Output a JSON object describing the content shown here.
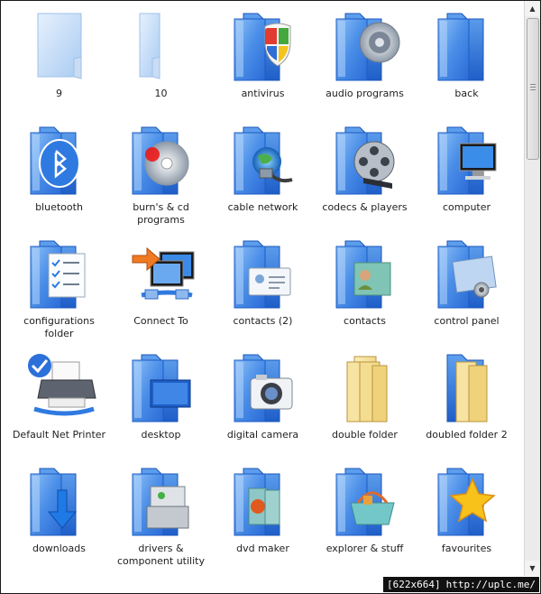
{
  "items": [
    {
      "label": "9",
      "icon": "plain-folder-icon"
    },
    {
      "label": "10",
      "icon": "narrow-folder-icon"
    },
    {
      "label": "antivirus",
      "icon": "shield-folder-icon"
    },
    {
      "label": "audio programs",
      "icon": "speaker-folder-icon"
    },
    {
      "label": "back",
      "icon": "empty-folder-icon"
    },
    {
      "label": "bluetooth",
      "icon": "bluetooth-folder-icon"
    },
    {
      "label": "burn's & cd programs",
      "icon": "disc-folder-icon"
    },
    {
      "label": "cable network",
      "icon": "globe-cable-folder-icon"
    },
    {
      "label": "codecs & players",
      "icon": "film-reel-folder-icon"
    },
    {
      "label": "computer",
      "icon": "monitor-folder-icon"
    },
    {
      "label": "configurations folder",
      "icon": "checklist-folder-icon"
    },
    {
      "label": "Connect To",
      "icon": "connect-monitors-icon"
    },
    {
      "label": "contacts (2)",
      "icon": "contact-card-folder-icon"
    },
    {
      "label": "contacts",
      "icon": "contacts-folder-icon"
    },
    {
      "label": "control panel",
      "icon": "control-panel-folder-icon"
    },
    {
      "label": "Default Net Printer",
      "icon": "printer-check-icon"
    },
    {
      "label": "desktop",
      "icon": "desktop-folder-icon"
    },
    {
      "label": "digital camera",
      "icon": "camera-folder-icon"
    },
    {
      "label": "double folder",
      "icon": "yellow-double-folder-icon"
    },
    {
      "label": "doubled folder 2",
      "icon": "yellow-blue-folder-icon"
    },
    {
      "label": "downloads",
      "icon": "download-arrow-folder-icon"
    },
    {
      "label": "drivers & component utility",
      "icon": "toolbox-folder-icon"
    },
    {
      "label": "dvd maker",
      "icon": "dvd-folder-icon"
    },
    {
      "label": "explorer & stuff",
      "icon": "basket-folder-icon"
    },
    {
      "label": "favourites",
      "icon": "star-folder-icon"
    }
  ],
  "watermark": {
    "dimensions": "[622x664]",
    "url": "http://uplc.me/"
  },
  "colors": {
    "folder_blue": "#3f86e6",
    "folder_dark": "#1e5fc7",
    "folder_light": "#a9cdf7",
    "folder_yellow": "#f2d889"
  }
}
